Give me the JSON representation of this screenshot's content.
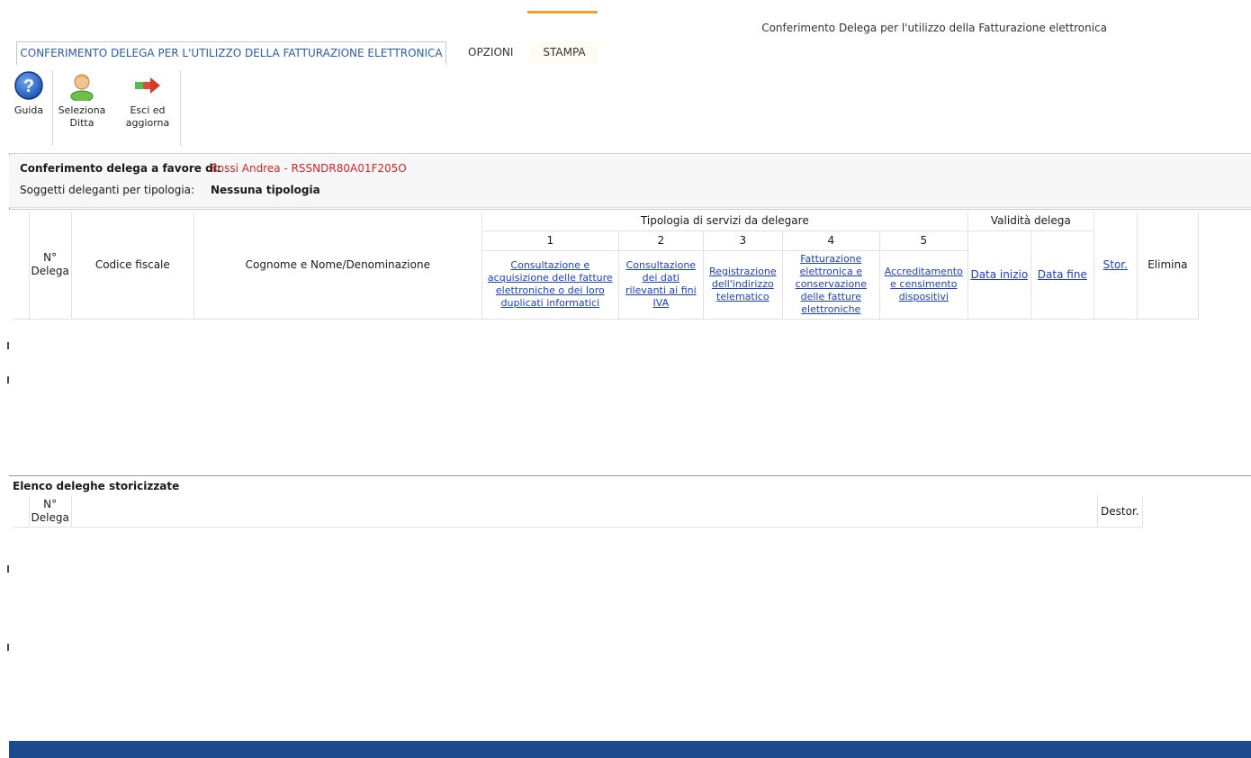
{
  "window": {
    "title": "Conferimento Delega per l'utilizzo della Fatturazione elettronica"
  },
  "ribbon": {
    "tabs": [
      {
        "label": "CONFERIMENTO DELEGA PER L'UTILIZZO DELLA FATTURAZIONE ELETTRONICA",
        "active": true
      },
      {
        "label": "OPZIONI"
      },
      {
        "label": "STAMPA"
      }
    ],
    "buttons": {
      "guida": "Guida",
      "seleziona_1": "Seleziona",
      "seleziona_2": "Ditta",
      "esci_1": "Esci ed",
      "esci_2": "aggiorna"
    }
  },
  "info": {
    "conferimento_label": "Conferimento delega a favore di:",
    "conferimento_value": "Rossi Andrea - RSSNDR80A01F205O",
    "soggetti_label": "Soggetti deleganti per tipologia:",
    "soggetti_value": "Nessuna tipologia"
  },
  "grid": {
    "col_n": "N°\nDelega",
    "col_cf": "Codice fiscale",
    "col_nome": "Cognome e Nome/Denominazione",
    "group_servizi": "Tipologia di servizi da delegare",
    "group_validita": "Validità delega",
    "services": [
      {
        "num": "1",
        "label": "Consultazione e acquisizione delle fatture elettroniche o dei loro duplicati informatici"
      },
      {
        "num": "2",
        "label": "Consultazione dei dati rilevanti ai fini IVA"
      },
      {
        "num": "3",
        "label": "Registrazione dell'indirizzo telematico"
      },
      {
        "num": "4",
        "label": "Fatturazione elettronica e conservazione delle fatture elettroniche"
      },
      {
        "num": "5",
        "label": "Accreditamento e censimento dispositivi"
      }
    ],
    "col_data_inizio": "Data inizio",
    "col_data_fine": "Data fine",
    "col_stor": "Stor.",
    "col_elimina": "Elimina",
    "rows": []
  },
  "history": {
    "title": "Elenco deleghe storicizzate",
    "col_n": "N°\nDelega",
    "col_destor": "Destor.",
    "rows": []
  },
  "colors": {
    "accent_tab": "#2a5ea8",
    "link": "#1a3ec8",
    "highlight_red": "#d3262a",
    "statusbar": "#1c4a8c",
    "context_tab": "#f0a030"
  },
  "icons": {
    "guida": "help-icon",
    "seleziona": "user-icon",
    "esci": "arrow-right-icon"
  }
}
